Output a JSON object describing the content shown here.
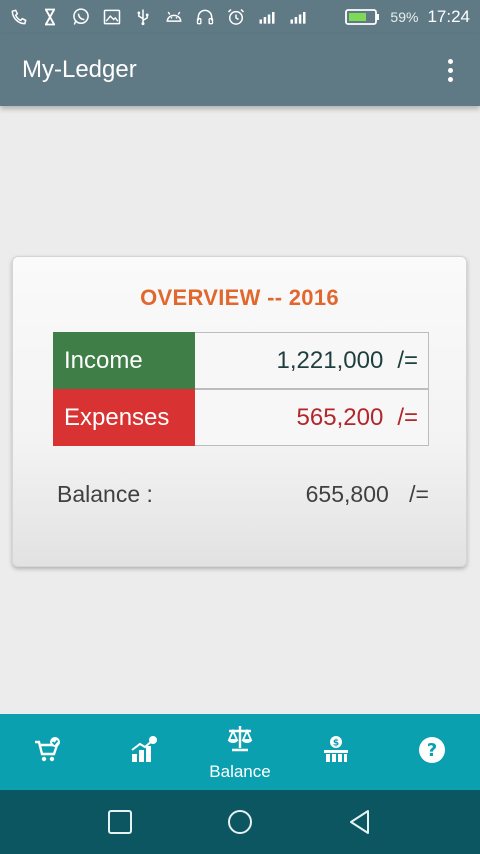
{
  "status_bar": {
    "icons": [
      "phone-missed-icon",
      "hourglass-icon",
      "whatsapp-icon",
      "image-icon",
      "usb-icon",
      "android-icon",
      "headset-icon",
      "alarm-icon",
      "signal-1-icon",
      "signal-2-icon",
      "battery-icon"
    ],
    "battery_percent": "59%",
    "time": "17:24"
  },
  "app_bar": {
    "title": "My-Ledger",
    "menu_icon": "more-vert-icon"
  },
  "overview": {
    "title": "OVERVIEW -- 2016",
    "income_label": "Income",
    "income_value": "1,221,000",
    "expenses_label": "Expenses",
    "expenses_value": "565,200",
    "balance_label": "Balance :",
    "balance_value": "655,800",
    "unit": "/="
  },
  "bottom_nav": {
    "items": [
      {
        "icon": "cart-check-icon",
        "label": ""
      },
      {
        "icon": "income-chart-icon",
        "label": ""
      },
      {
        "icon": "balance-scale-icon",
        "label": "Balance"
      },
      {
        "icon": "expenses-chart-icon",
        "label": ""
      },
      {
        "icon": "help-icon",
        "label": ""
      }
    ]
  },
  "colors": {
    "toolbar": "#5f7a85",
    "title_orange": "#e0682f",
    "income_green": "#3f7e46",
    "expenses_red": "#d93232",
    "bottom_nav": "#0aa0b0",
    "system_nav": "#0b5661"
  }
}
